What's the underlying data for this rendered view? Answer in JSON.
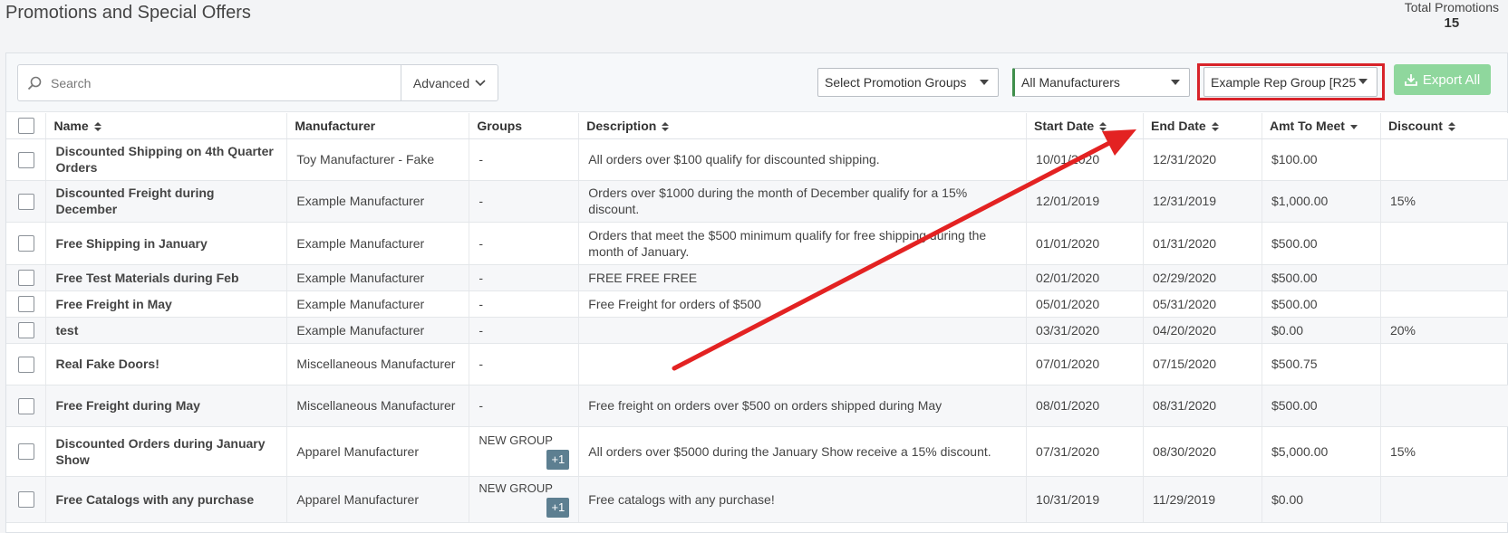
{
  "page": {
    "title": "Promotions and Special Offers",
    "total_label": "Total Promotions",
    "total_value": "15"
  },
  "toolbar": {
    "search_placeholder": "Search",
    "advanced_label": "Advanced",
    "promotion_groups_select": "Select Promotion Groups",
    "manufacturers_select": "All Manufacturers",
    "rep_group_select": "Example Rep Group [R25",
    "export_label": "Export All"
  },
  "columns": {
    "name": "Name",
    "manufacturer": "Manufacturer",
    "groups": "Groups",
    "description": "Description",
    "start_date": "Start Date",
    "end_date": "End Date",
    "amt_to_meet": "Amt To Meet",
    "discount": "Discount"
  },
  "rows": [
    {
      "name": "Discounted Shipping on 4th Quarter Orders",
      "manufacturer": "Toy Manufacturer - Fake",
      "groups": "-",
      "badge": "",
      "description": "All orders over $100 qualify for discounted shipping.",
      "start_date": "10/01/2020",
      "end_date": "12/31/2020",
      "amt": "$100.00",
      "discount": ""
    },
    {
      "name": "Discounted Freight during December",
      "manufacturer": "Example Manufacturer",
      "groups": "-",
      "badge": "",
      "description": "Orders over $1000 during the month of December qualify for a 15% discount.",
      "start_date": "12/01/2019",
      "end_date": "12/31/2019",
      "amt": "$1,000.00",
      "discount": "15%"
    },
    {
      "name": "Free Shipping in January",
      "manufacturer": "Example Manufacturer",
      "groups": "-",
      "badge": "",
      "description": "Orders that meet the $500 minimum qualify for free shipping during the month of January.",
      "start_date": "01/01/2020",
      "end_date": "01/31/2020",
      "amt": "$500.00",
      "discount": ""
    },
    {
      "name": "Free Test Materials during Feb",
      "manufacturer": "Example Manufacturer",
      "groups": "-",
      "badge": "",
      "description": "FREE FREE FREE",
      "start_date": "02/01/2020",
      "end_date": "02/29/2020",
      "amt": "$500.00",
      "discount": ""
    },
    {
      "name": "Free Freight in May",
      "manufacturer": "Example Manufacturer",
      "groups": "-",
      "badge": "",
      "description": "Free Freight for orders of $500",
      "start_date": "05/01/2020",
      "end_date": "05/31/2020",
      "amt": "$500.00",
      "discount": ""
    },
    {
      "name": "test",
      "manufacturer": "Example Manufacturer",
      "groups": "-",
      "badge": "",
      "description": "",
      "start_date": "03/31/2020",
      "end_date": "04/20/2020",
      "amt": "$0.00",
      "discount": "20%"
    },
    {
      "name": "Real Fake Doors!",
      "manufacturer": "Miscellaneous Manufacturer",
      "groups": "-",
      "badge": "",
      "description": "",
      "start_date": "07/01/2020",
      "end_date": "07/15/2020",
      "amt": "$500.75",
      "discount": ""
    },
    {
      "name": "Free Freight during May",
      "manufacturer": "Miscellaneous Manufacturer",
      "groups": "-",
      "badge": "",
      "description": "Free freight on orders over $500 on orders shipped during May",
      "start_date": "08/01/2020",
      "end_date": "08/31/2020",
      "amt": "$500.00",
      "discount": ""
    },
    {
      "name": "Discounted Orders during January Show",
      "manufacturer": "Apparel Manufacturer",
      "groups": "NEW GROUP",
      "badge": "+1",
      "description": "All orders over $5000 during the January Show receive a 15% discount.",
      "start_date": "07/31/2020",
      "end_date": "08/30/2020",
      "amt": "$5,000.00",
      "discount": "15%"
    },
    {
      "name": "Free Catalogs with any purchase",
      "manufacturer": "Apparel Manufacturer",
      "groups": "NEW GROUP",
      "badge": "+1",
      "description": "Free catalogs with any purchase!",
      "start_date": "10/31/2019",
      "end_date": "11/29/2019",
      "amt": "$0.00",
      "discount": ""
    }
  ],
  "colors": {
    "highlight": "#d8232a",
    "export_button": "#8fd79d",
    "manufacturer_accent": "#3f8f4b",
    "badge": "#5d7f91"
  },
  "icons": {
    "search": "magnifier-icon",
    "advanced": "chevron-down-icon",
    "export": "download-icon",
    "select": "caret-down-icon"
  }
}
